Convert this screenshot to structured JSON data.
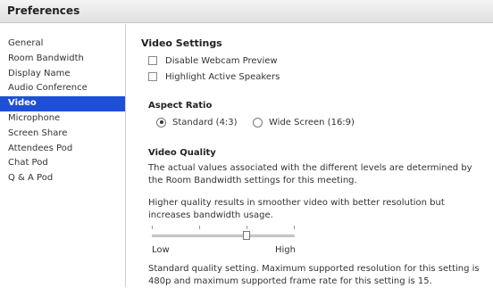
{
  "window": {
    "title": "Preferences"
  },
  "sidebar": {
    "items": [
      {
        "label": "General"
      },
      {
        "label": "Room Bandwidth"
      },
      {
        "label": "Display Name"
      },
      {
        "label": "Audio Conference"
      },
      {
        "label": "Video",
        "selected": true
      },
      {
        "label": "Microphone"
      },
      {
        "label": "Screen Share"
      },
      {
        "label": "Attendees Pod"
      },
      {
        "label": "Chat Pod"
      },
      {
        "label": "Q & A Pod"
      }
    ]
  },
  "video_settings": {
    "title": "Video Settings",
    "disable_webcam_preview": {
      "label": "Disable Webcam Preview",
      "checked": false
    },
    "highlight_active_speakers": {
      "label": "Highlight Active Speakers",
      "checked": false
    }
  },
  "aspect_ratio": {
    "title": "Aspect Ratio",
    "options": [
      {
        "label": "Standard (4:3)",
        "selected": true
      },
      {
        "label": "Wide Screen (16:9)",
        "selected": false
      }
    ]
  },
  "video_quality": {
    "title": "Video Quality",
    "desc1": "The actual values associated with the different levels are determined by the Room Bandwidth settings for this meeting.",
    "desc2": "Higher quality results in smoother video with better resolution but increases bandwidth usage.",
    "slider": {
      "min_label": "Low",
      "max_label": "High",
      "steps": 4,
      "value_step": 2
    },
    "status": "Standard quality setting. Maximum supported resolution for this setting is 480p and maximum supported frame rate for this setting is 15."
  }
}
